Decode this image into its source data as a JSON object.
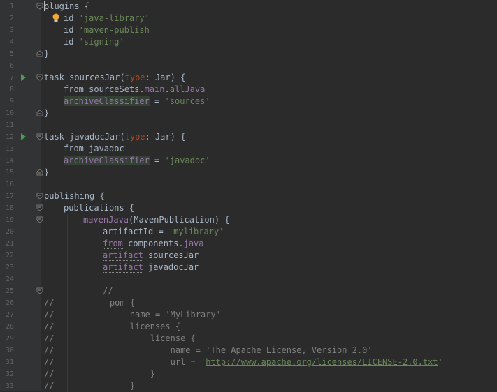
{
  "editor": {
    "lines": [
      {
        "n": "1",
        "indent": 0,
        "fold": "open",
        "tokens": [
          {
            "t": "plugins {",
            "c": ""
          }
        ]
      },
      {
        "n": "2",
        "indent": 1,
        "bulb": true,
        "tokens": [
          {
            "t": "id ",
            "c": ""
          },
          {
            "t": "'java-library'",
            "c": "str"
          }
        ]
      },
      {
        "n": "3",
        "indent": 1,
        "tokens": [
          {
            "t": "id ",
            "c": ""
          },
          {
            "t": "'maven-publish'",
            "c": "str"
          }
        ]
      },
      {
        "n": "4",
        "indent": 1,
        "tokens": [
          {
            "t": "id ",
            "c": ""
          },
          {
            "t": "'signing'",
            "c": "str"
          }
        ]
      },
      {
        "n": "5",
        "indent": 0,
        "fold": "close",
        "tokens": [
          {
            "t": "}",
            "c": ""
          }
        ]
      },
      {
        "n": "6",
        "indent": 0,
        "tokens": []
      },
      {
        "n": "7",
        "indent": 0,
        "run": true,
        "fold": "open",
        "tokens": [
          {
            "t": "task sourcesJar(",
            "c": ""
          },
          {
            "t": "type",
            "c": "named"
          },
          {
            "t": ": Jar) {",
            "c": ""
          }
        ]
      },
      {
        "n": "8",
        "indent": 1,
        "tokens": [
          {
            "t": "from sourceSets.",
            "c": ""
          },
          {
            "t": "main",
            "c": "prop"
          },
          {
            "t": ".",
            "c": ""
          },
          {
            "t": "allJava",
            "c": "prop"
          }
        ]
      },
      {
        "n": "9",
        "indent": 1,
        "tokens": [
          {
            "t": "archiveClassifier",
            "c": "prop field-hl"
          },
          {
            "t": " = ",
            "c": ""
          },
          {
            "t": "'sources'",
            "c": "str"
          }
        ]
      },
      {
        "n": "10",
        "indent": 0,
        "fold": "close",
        "tokens": [
          {
            "t": "}",
            "c": ""
          }
        ]
      },
      {
        "n": "11",
        "indent": 0,
        "tokens": []
      },
      {
        "n": "12",
        "indent": 0,
        "run": true,
        "fold": "open",
        "tokens": [
          {
            "t": "task javadocJar(",
            "c": ""
          },
          {
            "t": "type",
            "c": "named"
          },
          {
            "t": ": Jar) {",
            "c": ""
          }
        ]
      },
      {
        "n": "13",
        "indent": 1,
        "tokens": [
          {
            "t": "from javadoc",
            "c": ""
          }
        ]
      },
      {
        "n": "14",
        "indent": 1,
        "tokens": [
          {
            "t": "archiveClassifier",
            "c": "prop field-hl"
          },
          {
            "t": " = ",
            "c": ""
          },
          {
            "t": "'javadoc'",
            "c": "str"
          }
        ]
      },
      {
        "n": "15",
        "indent": 0,
        "fold": "close",
        "tokens": [
          {
            "t": "}",
            "c": ""
          }
        ]
      },
      {
        "n": "16",
        "indent": 0,
        "tokens": []
      },
      {
        "n": "17",
        "indent": 0,
        "fold": "open",
        "tokens": [
          {
            "t": "publishing {",
            "c": ""
          }
        ]
      },
      {
        "n": "18",
        "indent": 1,
        "fold": "open",
        "tokens": [
          {
            "t": "publications {",
            "c": ""
          }
        ]
      },
      {
        "n": "19",
        "indent": 2,
        "fold": "open",
        "tokens": [
          {
            "t": "mavenJava",
            "c": "prop dotted"
          },
          {
            "t": "(MavenPublication) {",
            "c": ""
          }
        ]
      },
      {
        "n": "20",
        "indent": 3,
        "tokens": [
          {
            "t": "artifactId = ",
            "c": ""
          },
          {
            "t": "'mylibrary'",
            "c": "str"
          }
        ]
      },
      {
        "n": "21",
        "indent": 3,
        "tokens": [
          {
            "t": "from",
            "c": "prop dotted"
          },
          {
            "t": " components.",
            "c": ""
          },
          {
            "t": "java",
            "c": "prop"
          }
        ]
      },
      {
        "n": "22",
        "indent": 3,
        "tokens": [
          {
            "t": "artifact",
            "c": "prop dotted"
          },
          {
            "t": " sourcesJar",
            "c": ""
          }
        ]
      },
      {
        "n": "23",
        "indent": 3,
        "tokens": [
          {
            "t": "artifact",
            "c": "prop dotted"
          },
          {
            "t": " javadocJar",
            "c": ""
          }
        ]
      },
      {
        "n": "24",
        "indent": 3,
        "tokens": []
      },
      {
        "n": "25",
        "indent": 3,
        "fold": "open",
        "tokens": [
          {
            "t": "//",
            "c": "cmt"
          }
        ]
      },
      {
        "n": "26",
        "indent": 0,
        "tokens": [
          {
            "t": "//           pom {",
            "c": "cmt"
          }
        ]
      },
      {
        "n": "27",
        "indent": 0,
        "tokens": [
          {
            "t": "//               name = 'MyLibrary'",
            "c": "cmt"
          }
        ]
      },
      {
        "n": "28",
        "indent": 0,
        "tokens": [
          {
            "t": "//               licenses {",
            "c": "cmt"
          }
        ]
      },
      {
        "n": "29",
        "indent": 0,
        "tokens": [
          {
            "t": "//                   license {",
            "c": "cmt"
          }
        ]
      },
      {
        "n": "30",
        "indent": 0,
        "tokens": [
          {
            "t": "//                       name = 'The Apache License, Version 2.0'",
            "c": "cmt"
          }
        ]
      },
      {
        "n": "31",
        "indent": 0,
        "tokens": [
          {
            "t": "//                       url = '",
            "c": "cmt"
          },
          {
            "t": "http://www.apache.org/licenses/LICENSE-2.0.txt",
            "c": "cmt link"
          },
          {
            "t": "'",
            "c": "cmt"
          }
        ]
      },
      {
        "n": "32",
        "indent": 0,
        "tokens": [
          {
            "t": "//                   }",
            "c": "cmt"
          }
        ]
      },
      {
        "n": "33",
        "indent": 0,
        "tokens": [
          {
            "t": "//               }",
            "c": "cmt"
          }
        ]
      }
    ]
  },
  "colors": {
    "background": "#2b2b2b",
    "gutter": "#313335",
    "keyword": "#cc7832",
    "string": "#6a8759",
    "property": "#9876aa",
    "comment": "#808080",
    "run_icon": "#499c54"
  }
}
